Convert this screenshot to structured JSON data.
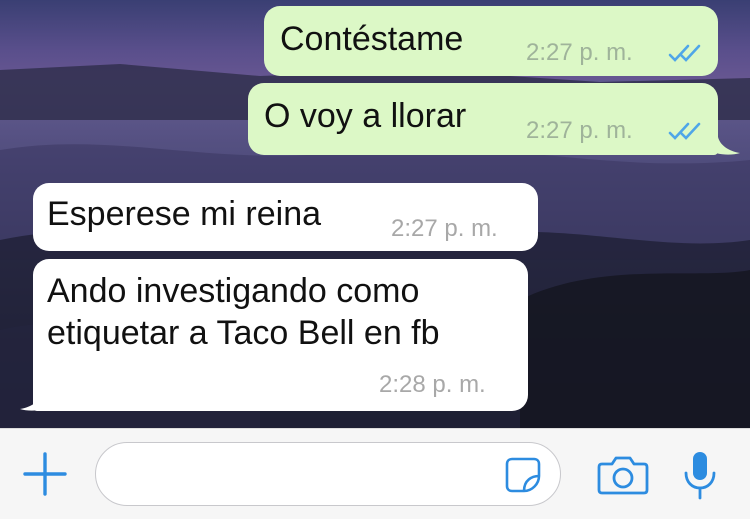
{
  "messages": [
    {
      "direction": "out",
      "text": "Contéstame",
      "time": "2:27 p. m.",
      "status": "read"
    },
    {
      "direction": "out",
      "text": "O voy a llorar",
      "time": "2:27 p. m.",
      "status": "read"
    },
    {
      "direction": "in",
      "text": "Esperese mi reina",
      "time": "2:27 p. m."
    },
    {
      "direction": "in",
      "text": "Ando investigando como etiquetar a Taco Bell en fb",
      "time": "2:28 p. m."
    }
  ],
  "composer": {
    "input_value": "",
    "icons": [
      "plus-icon",
      "sticker-icon",
      "camera-icon",
      "microphone-icon"
    ]
  },
  "colors": {
    "outgoing_bubble": "#dcf8c6",
    "incoming_bubble": "#ffffff",
    "accent": "#2d8ce0",
    "read_ticks": "#4fa6e8"
  }
}
